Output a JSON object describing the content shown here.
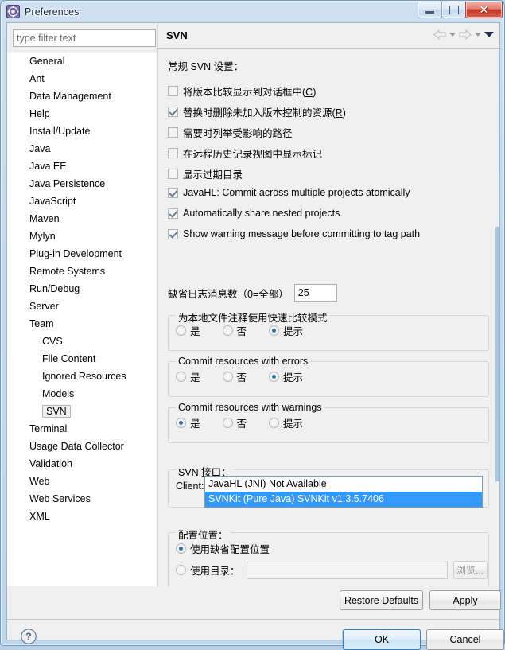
{
  "window": {
    "title": "Preferences",
    "icon": "gear-icon",
    "buttons": {
      "minimize": "minimize-icon",
      "maximize": "maximize-icon",
      "close": "✕"
    }
  },
  "sidebar": {
    "filter": {
      "placeholder": "type filter text",
      "value": ""
    },
    "items": [
      {
        "label": "General",
        "level": 0,
        "selected": false
      },
      {
        "label": "Ant",
        "level": 0,
        "selected": false
      },
      {
        "label": "Data Management",
        "level": 0,
        "selected": false
      },
      {
        "label": "Help",
        "level": 0,
        "selected": false
      },
      {
        "label": "Install/Update",
        "level": 0,
        "selected": false
      },
      {
        "label": "Java",
        "level": 0,
        "selected": false
      },
      {
        "label": "Java EE",
        "level": 0,
        "selected": false
      },
      {
        "label": "Java Persistence",
        "level": 0,
        "selected": false
      },
      {
        "label": "JavaScript",
        "level": 0,
        "selected": false
      },
      {
        "label": "Maven",
        "level": 0,
        "selected": false
      },
      {
        "label": "Mylyn",
        "level": 0,
        "selected": false
      },
      {
        "label": "Plug-in Development",
        "level": 0,
        "selected": false
      },
      {
        "label": "Remote Systems",
        "level": 0,
        "selected": false
      },
      {
        "label": "Run/Debug",
        "level": 0,
        "selected": false
      },
      {
        "label": "Server",
        "level": 0,
        "selected": false
      },
      {
        "label": "Team",
        "level": 0,
        "selected": false
      },
      {
        "label": "CVS",
        "level": 1,
        "selected": false
      },
      {
        "label": "File Content",
        "level": 1,
        "selected": false
      },
      {
        "label": "Ignored Resources",
        "level": 1,
        "selected": false
      },
      {
        "label": "Models",
        "level": 1,
        "selected": false
      },
      {
        "label": "SVN",
        "level": 1,
        "selected": true
      },
      {
        "label": "Terminal",
        "level": 0,
        "selected": false
      },
      {
        "label": "Usage Data Collector",
        "level": 0,
        "selected": false
      },
      {
        "label": "Validation",
        "level": 0,
        "selected": false
      },
      {
        "label": "Web",
        "level": 0,
        "selected": false
      },
      {
        "label": "Web Services",
        "level": 0,
        "selected": false
      },
      {
        "label": "XML",
        "level": 0,
        "selected": false
      }
    ]
  },
  "panel": {
    "title": "SVN",
    "nav": {
      "back": "back-arrow-icon",
      "back_menu": "chevron-down-icon",
      "forward": "forward-arrow-icon",
      "forward_menu": "chevron-down-icon",
      "view_menu": "chevron-down-icon"
    },
    "section_label": "常规 SVN 设置：",
    "checkboxes": [
      {
        "label": "将版本比较显示到对话框中(C)",
        "mnemonic": "C",
        "checked": false
      },
      {
        "label": "替换时删除未加入版本控制的资源(R)",
        "mnemonic": "R",
        "checked": true
      },
      {
        "label": "需要时列举受影响的路径",
        "mnemonic": "",
        "checked": false
      },
      {
        "label": "在远程历史记录视图中显示标记",
        "mnemonic": "",
        "checked": false
      },
      {
        "label": "显示过期目录",
        "mnemonic": "",
        "checked": false
      },
      {
        "label": "JavaHL: Commit across multiple projects atomically",
        "mnemonic": "m",
        "checked": true
      },
      {
        "label": "Automatically share nested projects",
        "mnemonic": "",
        "checked": true
      },
      {
        "label": "Show warning message before committing to tag path",
        "mnemonic": "",
        "checked": true
      }
    ],
    "log_messages": {
      "label": "缺省日志消息数（0=全部）",
      "value": "25"
    },
    "radio_groups": [
      {
        "title": "为本地文件注释使用快速比较模式",
        "options": [
          {
            "label": "是",
            "selected": false
          },
          {
            "label": "否",
            "selected": false
          },
          {
            "label": "提示",
            "selected": true
          }
        ]
      },
      {
        "title": "Commit resources with errors",
        "options": [
          {
            "label": "是",
            "selected": false
          },
          {
            "label": "否",
            "selected": false
          },
          {
            "label": "提示",
            "selected": true
          }
        ]
      },
      {
        "title": "Commit resources with warnings",
        "options": [
          {
            "label": "是",
            "selected": true
          },
          {
            "label": "否",
            "selected": false
          },
          {
            "label": "提示",
            "selected": false
          }
        ]
      }
    ],
    "svn_interface": {
      "title": "SVN 接口：",
      "client_label": "Client:",
      "client_value": "SVNKit (Pure Java) SVNKit v1.3.5.7406",
      "dropdown_open": true,
      "options": [
        {
          "label": "JavaHL (JNI) Not Available",
          "selected": false
        },
        {
          "label": "SVNKit (Pure Java) SVNKit v1.3.5.7406",
          "selected": true
        }
      ]
    },
    "config_location": {
      "title": "配置位置：",
      "options": [
        {
          "label": "使用缺省配置位置",
          "selected": true
        },
        {
          "label": "使用目录：",
          "selected": false
        }
      ],
      "directory_value": "",
      "browse_label": "浏览..."
    }
  },
  "footer": {
    "restore_defaults": "Restore Defaults",
    "restore_mnemonic": "D",
    "apply": "Apply",
    "apply_mnemonic": "A",
    "help": "help-icon",
    "ok": "OK",
    "cancel": "Cancel"
  },
  "colors": {
    "selection_blue": "#3399ff",
    "combo_blue": "#9fd0ef",
    "accent": "#2c6ca8"
  }
}
